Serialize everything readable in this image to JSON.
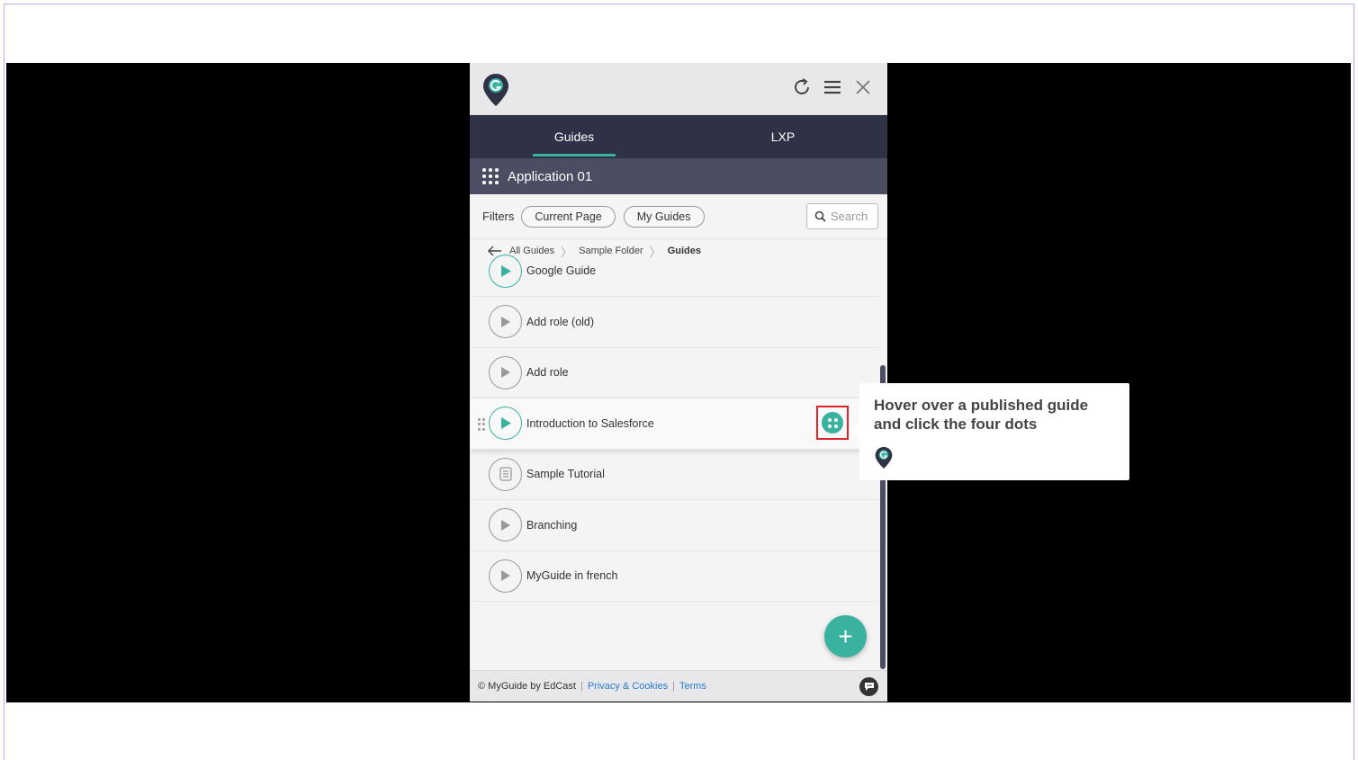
{
  "panel": {
    "tabs": [
      {
        "label": "Guides",
        "active": true
      },
      {
        "label": "LXP",
        "active": false
      }
    ],
    "app_name": "Application 01",
    "filters": {
      "label": "Filters",
      "pills": [
        "Current Page",
        "My Guides"
      ],
      "search_placeholder": "Search"
    },
    "breadcrumb": [
      "All Guides",
      "Sample Folder",
      "Guides"
    ],
    "guides": [
      {
        "title": "Google Guide",
        "icon": "play-icon",
        "published": true
      },
      {
        "title": "Add role (old)",
        "icon": "play-icon",
        "published": false
      },
      {
        "title": "Add role",
        "icon": "play-icon",
        "published": false
      },
      {
        "title": "Introduction to Salesforce",
        "icon": "play-icon",
        "published": true
      },
      {
        "title": "Sample Tutorial",
        "icon": "tutorial-icon",
        "published": false
      },
      {
        "title": "Branching",
        "icon": "play-icon",
        "published": false
      },
      {
        "title": "MyGuide in french",
        "icon": "play-icon",
        "published": false
      }
    ],
    "fab_label": "+",
    "footer": {
      "copyright": "© MyGuide by EdCast",
      "privacy": "Privacy & Cookies",
      "terms": "Terms"
    }
  },
  "tooltip": {
    "text": "Hover over a published guide and click the four dots"
  },
  "colors": {
    "accent": "#39b2a0",
    "tab_bar": "#2f3246",
    "app_bar": "#4b4e63",
    "highlight": "#e0242b"
  }
}
